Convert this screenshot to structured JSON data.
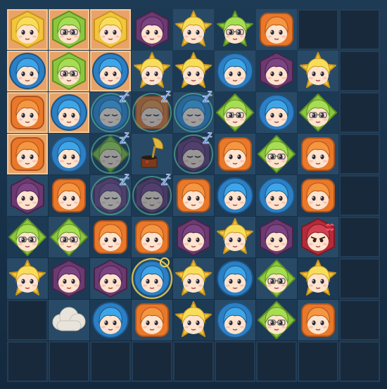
{
  "colors": {
    "blonde": {
      "fill": "#f2c53d",
      "hair": "#f7de5a",
      "shade": "#c9941c"
    },
    "green": {
      "fill": "#8cc63f",
      "hair": "#a6dd52",
      "shade": "#5c8f22"
    },
    "blue": {
      "fill": "#2c7fc4",
      "hair": "#3ea6e8",
      "shade": "#1b5485"
    },
    "orange": {
      "fill": "#e9782a",
      "hair": "#f59640",
      "shade": "#b0521a"
    },
    "purple": {
      "fill": "#6b3a70",
      "hair": "#7d4483",
      "shade": "#46234b"
    },
    "red": {
      "fill": "#b52b3a",
      "hair": "#d34050",
      "shade": "#7a1a24"
    }
  },
  "grid": {
    "rows": 9,
    "cols": 9,
    "cells": [
      [
        "blonde-hex",
        "green-hex",
        "blonde-hex",
        "purple-hex",
        "blonde-star",
        "green-star",
        "orange-square",
        "blocked",
        "blocked"
      ],
      [
        "blue-circle",
        "green-hex",
        "blue-circle",
        "blonde-star",
        "blonde-star",
        "blue-circle",
        "purple-hex",
        "blonde-star",
        "blocked"
      ],
      [
        "orange-square",
        "blue-circle",
        "blue-sleeping",
        "orange-sleeping",
        "blue-sleeping",
        "green-diamond",
        "blue-circle",
        "green-diamond",
        "blocked"
      ],
      [
        "orange-square",
        "blue-circle",
        "green-sleeping",
        "gramophone",
        "purple-sleeping",
        "orange-square",
        "green-diamond",
        "orange-square",
        "blocked"
      ],
      [
        "purple-hex",
        "orange-square",
        "purple-sleeping",
        "purple-sleeping",
        "orange-square",
        "blue-circle",
        "blue-circle",
        "orange-square",
        "blocked"
      ],
      [
        "green-diamond",
        "green-diamond",
        "orange-square",
        "orange-square",
        "purple-hex",
        "blonde-star",
        "purple-hex",
        "red-angry",
        "blocked"
      ],
      [
        "blonde-star",
        "purple-hex",
        "purple-hex",
        "blue-selected",
        "blonde-star",
        "blue-circle",
        "green-diamond",
        "blonde-star",
        "blocked"
      ],
      [
        "blocked",
        "cloud",
        "blue-circle",
        "orange-square",
        "blonde-star",
        "blue-circle",
        "green-diamond",
        "orange-square",
        "blocked"
      ],
      [
        "blocked",
        "blocked",
        "blocked",
        "blocked",
        "blocked",
        "blocked",
        "blocked",
        "blocked",
        "blocked"
      ]
    ],
    "highlighted": [
      [
        0,
        0
      ],
      [
        0,
        1
      ],
      [
        0,
        2
      ],
      [
        1,
        0
      ],
      [
        1,
        1
      ],
      [
        1,
        2
      ],
      [
        2,
        0
      ],
      [
        2,
        1
      ],
      [
        3,
        0
      ]
    ]
  }
}
